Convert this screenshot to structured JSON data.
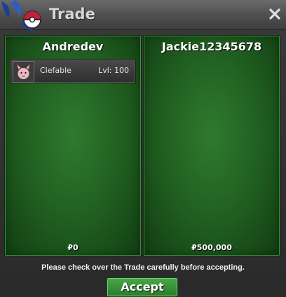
{
  "window": {
    "title": "Trade",
    "close_icon": "close-icon"
  },
  "left_panel": {
    "player_name": "Andredev",
    "items": [
      {
        "name": "Clefable",
        "level": "Lvl: 100",
        "icon": "clefable-sprite"
      }
    ],
    "money": "₽0"
  },
  "right_panel": {
    "player_name": "Jackie12345678",
    "items": [],
    "money": "₽500,000"
  },
  "footer": {
    "notice": "Please check over the Trade carefully before accepting.",
    "accept_label": "Accept"
  },
  "colors": {
    "panel_green": "#1f5c1f",
    "accent_red": "#c0203a",
    "button_green": "#3a963a"
  }
}
